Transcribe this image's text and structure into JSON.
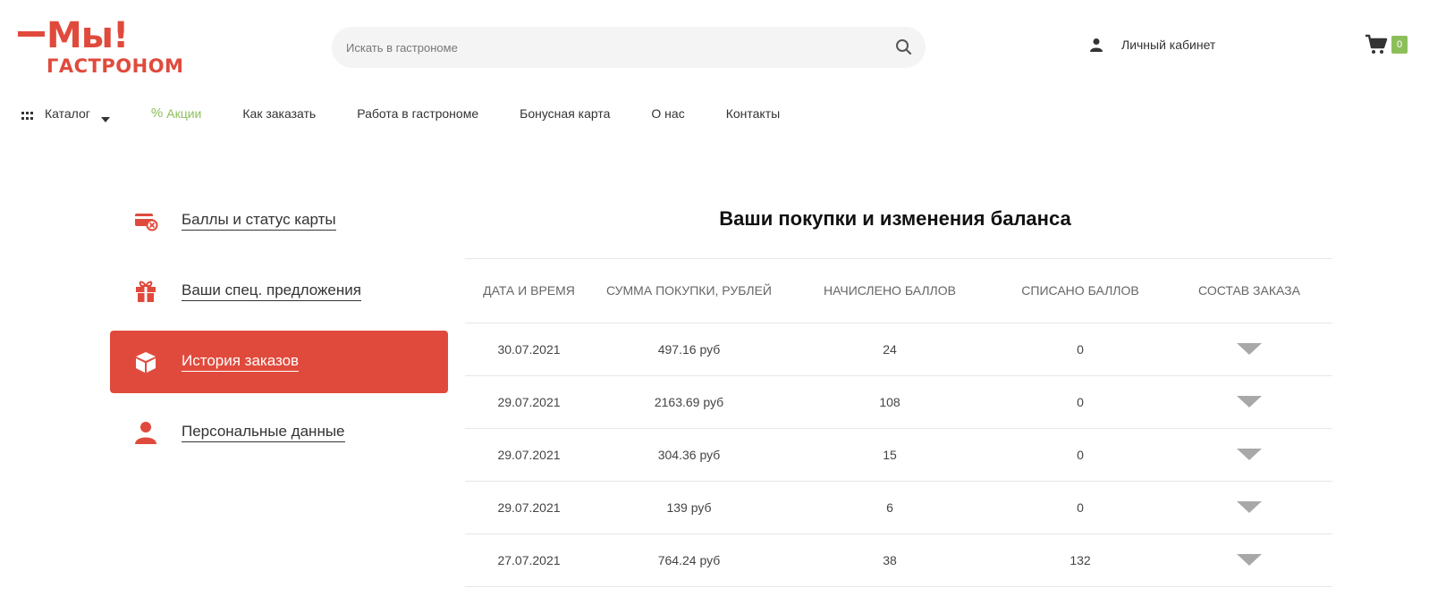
{
  "header": {
    "logo_top": "Мы!",
    "logo_bottom": "ГАСТРОНОМ",
    "search_placeholder": "Искать в гастрономе",
    "account_label": "Личный кабинет",
    "cart_count": "0"
  },
  "nav": {
    "items": [
      {
        "label": "Каталог"
      },
      {
        "label": "Акции"
      },
      {
        "label": "Как заказать"
      },
      {
        "label": "Работа в гастрономе"
      },
      {
        "label": "Бонусная карта"
      },
      {
        "label": "О нас"
      },
      {
        "label": "Контакты"
      }
    ]
  },
  "sidebar": {
    "items": [
      {
        "label": "Баллы и статус карты",
        "icon": "card-status-icon"
      },
      {
        "label": "Ваши спец. предложения",
        "icon": "gift-icon"
      },
      {
        "label": "История заказов",
        "icon": "box-icon",
        "active": true
      },
      {
        "label": "Персональные данные",
        "icon": "user-icon"
      }
    ]
  },
  "main": {
    "title": "Ваши покупки и изменения баланса",
    "columns": [
      "Дата и время",
      "Сумма покупки, рублей",
      "Начислено баллов",
      "Списано баллов",
      "Состав заказа"
    ],
    "rows": [
      {
        "date": "30.07.2021",
        "sum": "497.16 руб",
        "earned": "24",
        "spent": "0"
      },
      {
        "date": "29.07.2021",
        "sum": "2163.69 руб",
        "earned": "108",
        "spent": "0"
      },
      {
        "date": "29.07.2021",
        "sum": "304.36 руб",
        "earned": "15",
        "spent": "0"
      },
      {
        "date": "29.07.2021",
        "sum": "139 руб",
        "earned": "6",
        "spent": "0"
      },
      {
        "date": "27.07.2021",
        "sum": "764.24 руб",
        "earned": "38",
        "spent": "132"
      }
    ]
  },
  "colors": {
    "brand_red": "#e04a3c",
    "promo_green": "#8cbf5a"
  }
}
